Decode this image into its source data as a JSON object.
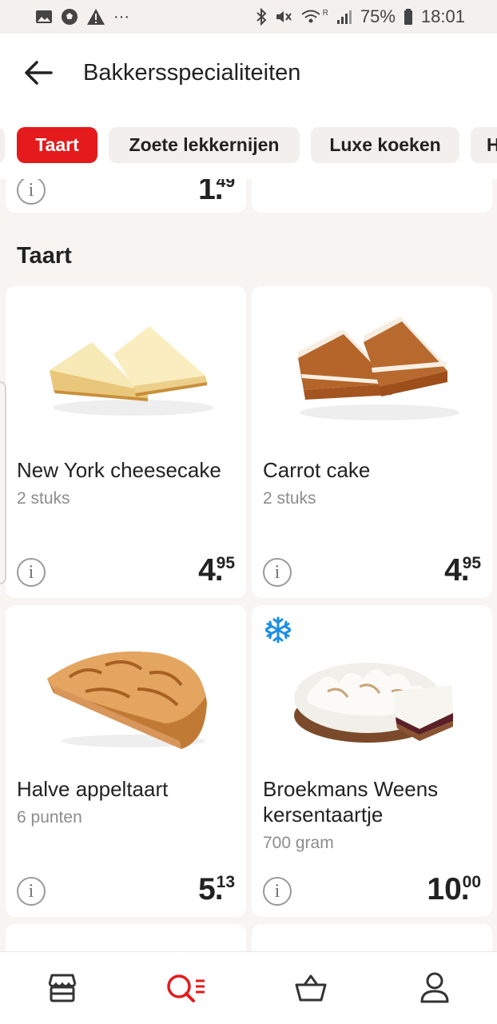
{
  "status_bar": {
    "battery": "75%",
    "time": "18:01",
    "network": "R"
  },
  "header": {
    "title": "Bakkersspecialiteiten"
  },
  "tabs": [
    {
      "label": "Taart",
      "active": true
    },
    {
      "label": "Zoete lekkernijen",
      "active": false
    },
    {
      "label": "Luxe koeken",
      "active": false
    },
    {
      "label": "H",
      "active": false
    }
  ],
  "previous_row": {
    "price_euro": "1",
    "price_cents": "49"
  },
  "section": {
    "title": "Taart"
  },
  "products": [
    {
      "name": "New York cheesecake",
      "unit": "2 stuks",
      "price_euro": "4",
      "price_cents": "95",
      "frozen": false
    },
    {
      "name": "Carrot cake",
      "unit": "2 stuks",
      "price_euro": "4",
      "price_cents": "95",
      "frozen": false
    },
    {
      "name": "Halve appeltaart",
      "unit": "6 punten",
      "price_euro": "5",
      "price_cents": "13",
      "frozen": false
    },
    {
      "name": "Broekmans Weens kersentaartje",
      "unit": "700 gram",
      "price_euro": "10",
      "price_cents": "00",
      "frozen": true
    }
  ],
  "colors": {
    "accent": "#e41a1c",
    "frozen_icon": "#1a8fe3",
    "background": "#f7f4f2"
  },
  "nav": [
    {
      "name": "store-icon",
      "active": false
    },
    {
      "name": "search-list-icon",
      "active": true
    },
    {
      "name": "basket-icon",
      "active": false
    },
    {
      "name": "profile-icon",
      "active": false
    }
  ]
}
